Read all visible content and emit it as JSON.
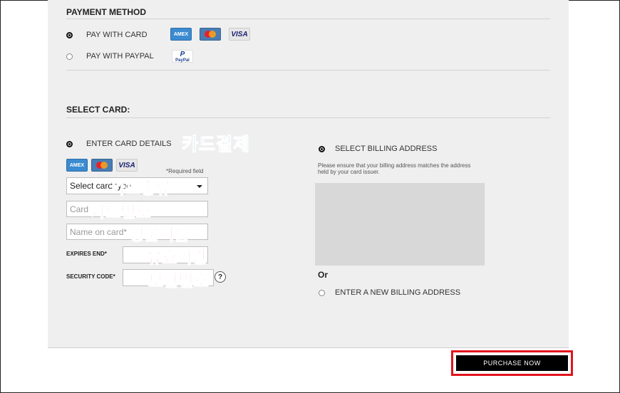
{
  "payment_method": {
    "heading": "PAYMENT METHOD",
    "options": [
      {
        "label": "PAY WITH CARD",
        "selected": true
      },
      {
        "label": "PAY WITH PAYPAL",
        "selected": false
      }
    ],
    "card_logos": [
      "amex-icon",
      "mastercard-icon",
      "visa-icon"
    ],
    "paypal_logo": "paypal-icon"
  },
  "select_card": {
    "heading": "SELECT CARD:",
    "enter_card_label": "ENTER CARD DETAILS",
    "required_note": "*Required field",
    "card_type": {
      "value": "Select card type"
    },
    "card_number": {
      "placeholder": "Card"
    },
    "name_on_card": {
      "placeholder": "Name on card*"
    },
    "expires_label": "EXPIRES END*",
    "security_label": "SECURITY CODE*",
    "help_glyph": "?"
  },
  "billing": {
    "select_label": "SELECT BILLING ADDRESS",
    "note": "Please ensure that your billing address matches the address held by your card issuer.",
    "or_label": "Or",
    "new_label": "ENTER A NEW BILLING ADDRESS"
  },
  "annotations": {
    "card_payment": "카드결제",
    "card_type": "카드종류",
    "card_number": "카드번호",
    "english_name": "영문이름",
    "expiry": "유효기간",
    "security": "보안번호"
  },
  "purchase": {
    "label": "PURCHASE NOW"
  },
  "colors": {
    "panel": "#efefef",
    "highlight": "#e3141e",
    "annotation_blue": "#1fa4d8",
    "annotation_red": "#e01010"
  }
}
